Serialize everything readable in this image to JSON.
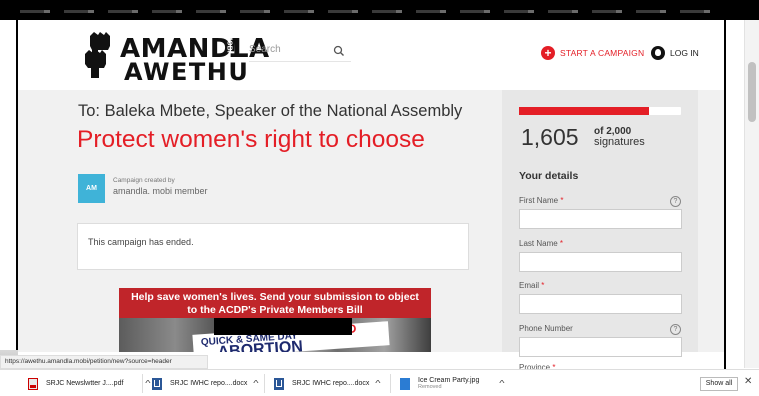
{
  "header": {
    "logo_line1": "AMANDLA",
    "logo_mark": "!",
    "logo_suffix": "MOBI",
    "logo_line2": "AWETHU",
    "search_placeholder": "Search",
    "start_campaign_label": "START A CAMPAIGN",
    "login_label": "LOG IN"
  },
  "campaign": {
    "recipient": "To: Baleka Mbete, Speaker of the National Assembly",
    "title": "Protect women's right to choose",
    "avatar_initials": "AM",
    "created_by_label": "Campaign created by",
    "creator_name": "amandla. mobi member",
    "ended_message": "This campaign has ended."
  },
  "banner": {
    "line1": "Help save women's lives. Send your submission to object",
    "line2": "to the ACDP's Private Members Bill",
    "sign_line1": "QUICK & SAME DAY",
    "sign_line2": "ABORTION",
    "sign_tag": "ED"
  },
  "signatures": {
    "count": "1,605",
    "goal_prefix": "of 2,000",
    "goal_suffix": "signatures",
    "progress_fraction": 0.8025
  },
  "form": {
    "title": "Your details",
    "fields": [
      {
        "label": "First Name",
        "required": "*",
        "help": "?"
      },
      {
        "label": "Last Name",
        "required": "*"
      },
      {
        "label": "Email",
        "required": "*"
      },
      {
        "label": "Phone Number",
        "help": "?"
      },
      {
        "label": "Province",
        "required": "*"
      }
    ]
  },
  "status_url": "https://awethu.amandla.mobi/petition/new?source=header",
  "downloads": [
    {
      "name": "SRJC Newslwtter J....pdf",
      "icon": "pdf-icon"
    },
    {
      "name": "SRJC IWHC repo....docx",
      "icon": "word-doc-icon"
    },
    {
      "name": "SRJC IWHC repo....docx",
      "icon": "word-doc-icon"
    },
    {
      "name": "Ice Cream Party.jpg",
      "sub": "Removed",
      "icon": "image-icon"
    }
  ],
  "shelf": {
    "show_all": "Show all",
    "close": "✕",
    "chevron": "^"
  },
  "colors": {
    "brand_red": "#e41e26",
    "avatar_blue": "#3fb3d8"
  }
}
